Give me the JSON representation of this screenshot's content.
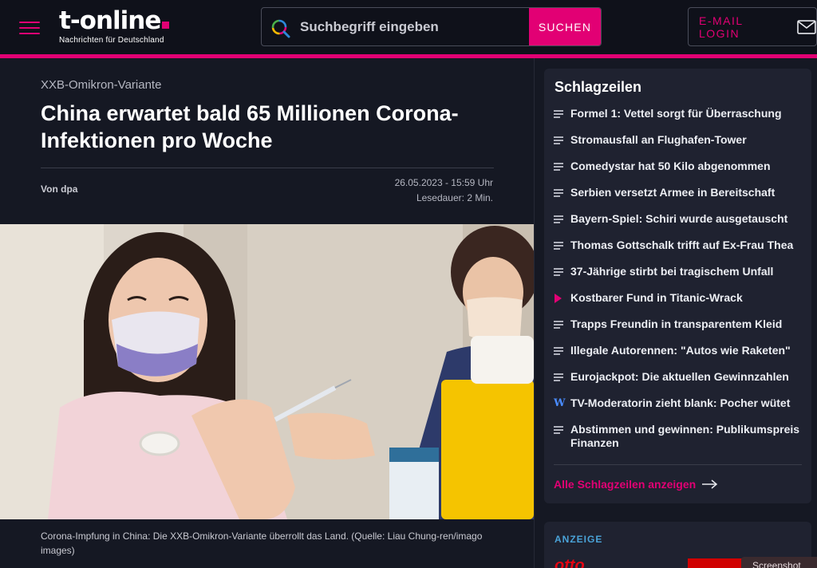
{
  "header": {
    "logo_text": "t-online",
    "logo_tagline": "Nachrichten für Deutschland",
    "search_placeholder": "Suchbegriff eingeben",
    "search_button": "SUCHEN",
    "email_login": "E-MAIL LOGIN"
  },
  "article": {
    "kicker": "XXB-Omikron-Variante",
    "headline": "China erwartet bald 65 Millionen Corona-Infektionen pro Woche",
    "author": "Von dpa",
    "date": "26.05.2023 - 15:59 Uhr",
    "reading_time": "Lesedauer: 2 Min.",
    "caption": "Corona-Impfung in China: Die XXB-Omikron-Variante überrollt das Land. (Quelle: Liau Chung-ren/imago images)"
  },
  "sidebar": {
    "title": "Schlagzeilen",
    "items": [
      {
        "label": "Formel 1: Vettel sorgt für Überraschung",
        "icon": "lines-icon"
      },
      {
        "label": "Stromausfall an Flughafen-Tower",
        "icon": "lines-icon"
      },
      {
        "label": "Comedystar hat 50 Kilo abgenommen",
        "icon": "lines-icon"
      },
      {
        "label": "Serbien versetzt Armee in Bereitschaft",
        "icon": "lines-icon"
      },
      {
        "label": "Bayern-Spiel: Schiri wurde ausgetauscht",
        "icon": "lines-icon"
      },
      {
        "label": "Thomas Gottschalk trifft auf Ex-Frau Thea",
        "icon": "lines-icon"
      },
      {
        "label": "37-Jährige stirbt bei tragischem Unfall",
        "icon": "lines-icon"
      },
      {
        "label": "Kostbarer Fund in Titanic-Wrack",
        "icon": "play-icon"
      },
      {
        "label": "Trapps Freundin in transparentem Kleid",
        "icon": "lines-icon"
      },
      {
        "label": "Illegale Autorennen: \"Autos wie Raketen\"",
        "icon": "lines-icon"
      },
      {
        "label": "Eurojackpot: Die aktuellen Gewinnzahlen",
        "icon": "lines-icon"
      },
      {
        "label": "TV-Moderatorin zieht blank: Pocher wütet",
        "icon": "w-icon"
      },
      {
        "label": "Abstimmen und gewinnen: Publikumspreis Finanzen",
        "icon": "lines-icon"
      }
    ],
    "all_link": "Alle Schlagzeilen anzeigen"
  },
  "ad": {
    "label": "ANZEIGE",
    "brand": "otto"
  },
  "overlay": {
    "screenshot_label": "Screenshot"
  },
  "colors": {
    "accent": "#e20074",
    "background": "#151823",
    "panel": "#1f2230"
  }
}
